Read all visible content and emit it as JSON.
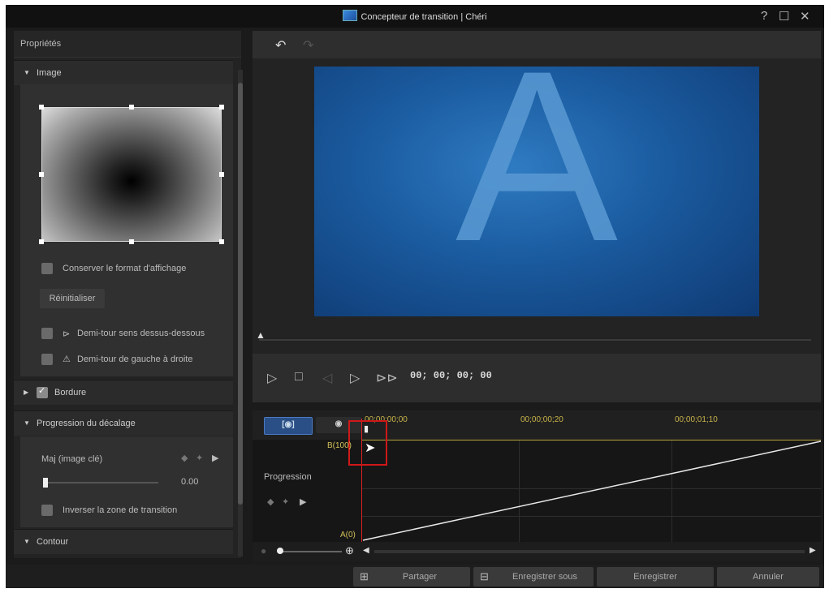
{
  "window": {
    "title": "Concepteur de transition  |  Chéri",
    "help": "?",
    "maximize": "☐",
    "close": "✕"
  },
  "properties": {
    "header": "Propriétés",
    "image_section": "Image",
    "keep_format": "Conserver le format d'affichage",
    "reset": "Réinitialiser",
    "flip_vertical": "Demi-tour sens dessus-dessous",
    "flip_horizontal": "Demi-tour de gauche à droite",
    "border_section": "Bordure",
    "offset_section": "Progression du décalage",
    "keyframe_label": "Maj (image clé)",
    "offset_value": "0.00",
    "invert_zone": "Inverser la zone de transition",
    "contour_section": "Contour"
  },
  "preview": {
    "letter": "A",
    "timecode": "00; 00; 00; 00"
  },
  "timeline": {
    "tab_active": "[◉]",
    "tab_other": "◉",
    "ticks": [
      "00;00;00;00",
      "00;00;00;20",
      "00;00;01;10"
    ],
    "kf_top": "B(100)",
    "kf_bottom": "A(0)",
    "track_label": "Progression"
  },
  "footer": {
    "share": "Partager",
    "save_as": "Enregistrer sous",
    "save": "Enregistrer",
    "cancel": "Annuler"
  }
}
